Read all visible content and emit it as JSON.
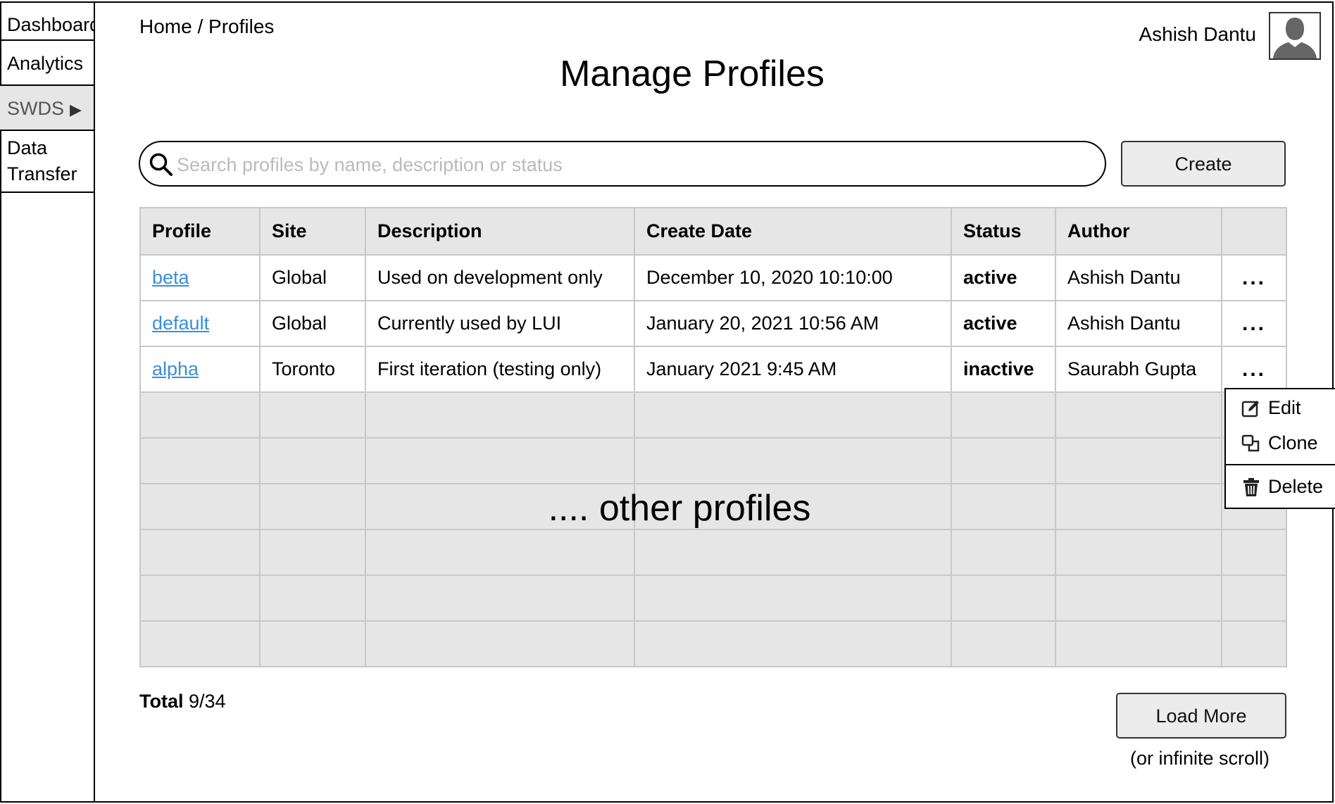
{
  "sidebar": {
    "items": [
      {
        "label": "Dashboard"
      },
      {
        "label": "Analytics"
      },
      {
        "label": "SWDS",
        "arrow": "▶"
      },
      {
        "label": "Data Transfer"
      }
    ]
  },
  "breadcrumb": {
    "home": "Home",
    "separator": " / ",
    "current": "Profiles"
  },
  "page": {
    "title": "Manage Profiles"
  },
  "user": {
    "name": "Ashish Dantu",
    "avatar_icon": "user-silhouette-icon"
  },
  "search": {
    "placeholder": "Search profiles by name, description or status",
    "value": "",
    "icon": "search-icon"
  },
  "toolbar": {
    "create_label": "Create"
  },
  "table": {
    "headers": [
      "Profile",
      "Site",
      "Description",
      "Create Date",
      "Status",
      "Author",
      ""
    ],
    "rows": [
      {
        "profile": "beta",
        "site": "Global",
        "description": "Used on development only",
        "create_date": "December 10, 2020 10:10:00",
        "status": "active",
        "author": "Ashish Dantu",
        "actions": "..."
      },
      {
        "profile": "default",
        "site": "Global",
        "description": "Currently used by LUI",
        "create_date": "January 20, 2021 10:56 AM",
        "status": "active",
        "author": "Ashish Dantu",
        "actions": "..."
      },
      {
        "profile": "alpha",
        "site": "Toronto",
        "description": "First iteration (testing only)",
        "create_date": "January 2021 9:45 AM",
        "status": "inactive",
        "author": "Saurabh Gupta",
        "actions": "..."
      }
    ],
    "placeholder_text": ".... other profiles"
  },
  "context_menu": {
    "items": [
      {
        "label": "Edit",
        "icon": "edit-icon"
      },
      {
        "label": "Clone",
        "icon": "clone-icon"
      },
      {
        "label": "Delete",
        "icon": "trash-icon"
      }
    ]
  },
  "footer": {
    "total_label": "Total",
    "total_value": "9/34",
    "load_more_label": "Load More",
    "scroll_note": "(or infinite scroll)"
  },
  "colors": {
    "link": "#3a8fd8",
    "header_bg": "#e6e6e6",
    "button_bg": "#ececec",
    "placeholder": "#bbbbbb"
  }
}
